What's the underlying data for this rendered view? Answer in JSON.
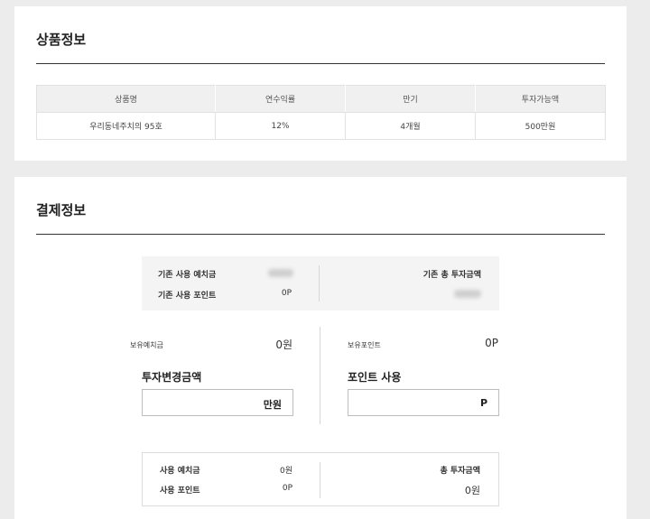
{
  "product": {
    "title": "상품정보",
    "headers": [
      "상품명",
      "연수익률",
      "만기",
      "투자가능액"
    ],
    "row": [
      "우리동네주치의 95호",
      "12%",
      "4개월",
      "500만원"
    ]
  },
  "payment": {
    "title": "결제정보",
    "summary_top": {
      "existing_deposit_label": "기존 사용 예치금",
      "existing_point_label": "기존 사용 포인트",
      "existing_point_value": "0P",
      "existing_total_label": "기존 총 투자금액"
    },
    "holdings": {
      "deposit_label": "보유예치금",
      "deposit_value": "0원",
      "point_label": "보유포인트",
      "point_value": "0P"
    },
    "change_amount": {
      "title": "투자변경금액",
      "value": "",
      "unit": "만원"
    },
    "point_use": {
      "title": "포인트 사용",
      "value": "",
      "unit": "P"
    },
    "summary_bottom": {
      "deposit_label": "사용 예치금",
      "deposit_value": "0원",
      "point_label": "사용 포인트",
      "point_value": "0P",
      "total_label": "총 투자금액",
      "total_value": "0원"
    }
  }
}
